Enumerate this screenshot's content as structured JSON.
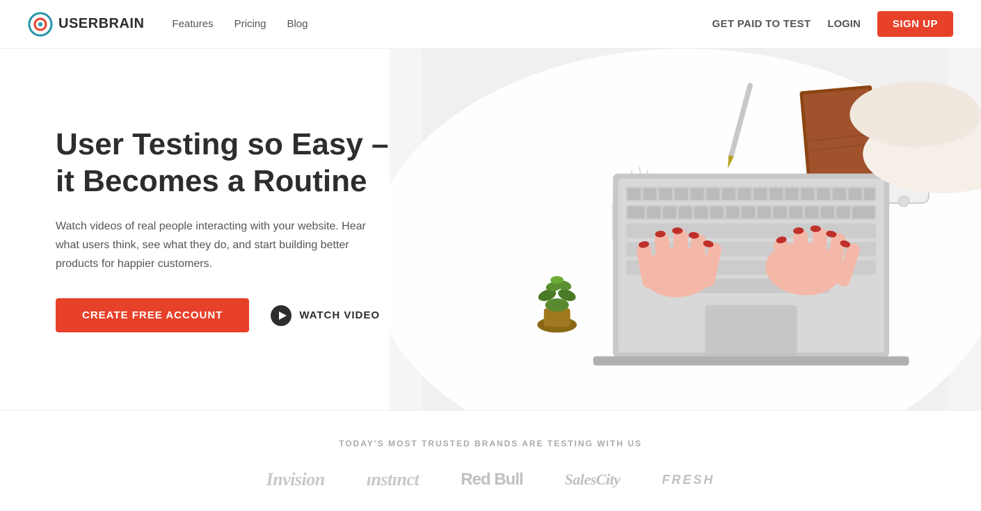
{
  "nav": {
    "logo_text": "USERBRAIN",
    "links": [
      {
        "label": "Features",
        "id": "features"
      },
      {
        "label": "Pricing",
        "id": "pricing"
      },
      {
        "label": "Blog",
        "id": "blog"
      }
    ],
    "get_paid_label": "GET PAID TO TEST",
    "login_label": "LOGIN",
    "signup_label": "SIGN UP"
  },
  "hero": {
    "title": "User Testing so Easy – it Becomes a Routine",
    "description": "Watch videos of real people interacting with your website. Hear what users think, see what they do, and start building better products for happier customers.",
    "cta_primary": "CREATE FREE ACCOUNT",
    "cta_secondary": "WATCH VIDEO"
  },
  "trusted": {
    "label": "TODAY'S MOST TRUSTED BRANDS ARE TESTING WITH US",
    "brands": [
      {
        "name": "Invision",
        "style": "cursive"
      },
      {
        "name": "Instinct",
        "style": "cursive"
      },
      {
        "name": "Red Bull",
        "style": "normal"
      },
      {
        "name": "SalesCity",
        "style": "italic"
      },
      {
        "name": "FRESH",
        "style": "normal"
      }
    ]
  },
  "colors": {
    "accent": "#e8412a",
    "text_dark": "#2d2d2d",
    "text_mid": "#555555",
    "text_light": "#aaaaaa"
  }
}
